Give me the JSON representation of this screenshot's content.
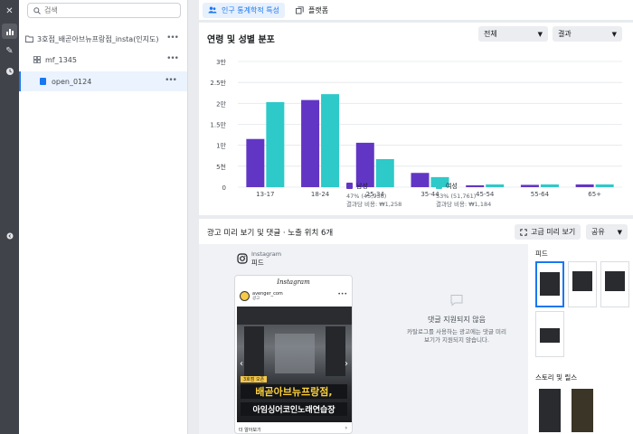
{
  "sidebar": {
    "search": {
      "placeholder": "검색"
    },
    "items": [
      {
        "label": "3호점_배곧아브뉴프랑점_insta(인지도)"
      },
      {
        "label": "mf_1345"
      },
      {
        "label": "open_0124"
      }
    ]
  },
  "header": {
    "tabs": [
      {
        "label": "인구 통계학적 특성"
      },
      {
        "label": "플랫폼"
      }
    ]
  },
  "chart_card": {
    "title": "연령 및 성별 분포",
    "dropdown_all": "전체",
    "dropdown_result": "결과"
  },
  "chart_data": {
    "type": "bar",
    "categories": [
      "13-17",
      "18-24",
      "25-34",
      "35-44",
      "45-54",
      "55-64",
      "65+"
    ],
    "y_ticks": [
      "0",
      "5천",
      "1만",
      "1.5만",
      "2만",
      "2.5만",
      "3만"
    ],
    "ylim": [
      0,
      30000
    ],
    "grid": true,
    "series": [
      {
        "name": "남성",
        "color": "#6236c4",
        "values": [
          11500,
          20800,
          10600,
          3400,
          450,
          550,
          650
        ]
      },
      {
        "name": "여성",
        "color": "#2ec9c9",
        "values": [
          20300,
          22200,
          6700,
          2400,
          650,
          650,
          650
        ]
      }
    ],
    "legend": [
      {
        "name": "남성",
        "percent": "47% (45,936)",
        "cost": "결과당 비용: ₩1,258"
      },
      {
        "name": "여성",
        "percent": "53% (51,761)",
        "cost": "결과당 비용: ₩1,184"
      }
    ]
  },
  "preview": {
    "title": "광고 미리 보기 및 댓글 · 노출 위치 6개",
    "advanced_button": "고급 미리 보기",
    "share_button": "공유",
    "platform_name": "Instagram",
    "platform_sub": "피드",
    "phone_brand": "Instagram",
    "account_name": "avenger_com",
    "account_sub": "광고",
    "ad_tag": "3호점 오픈",
    "ad_line1": "배곧아브뉴프랑점,",
    "ad_line2": "아임싱어코인노래연습장",
    "ad_more": "더 알아보기",
    "nocomment_title": "댓글 지원되지 않음",
    "nocomment_desc": "카탈로그를 사용하는 광고에는 댓글 미리 보기가 지원되지 않습니다.",
    "feed_label": "피드",
    "stories_label": "스토리 및 릴스"
  },
  "colors": {
    "accent": "#1877f2",
    "male": "#6236c4",
    "female": "#2ec9c9"
  }
}
